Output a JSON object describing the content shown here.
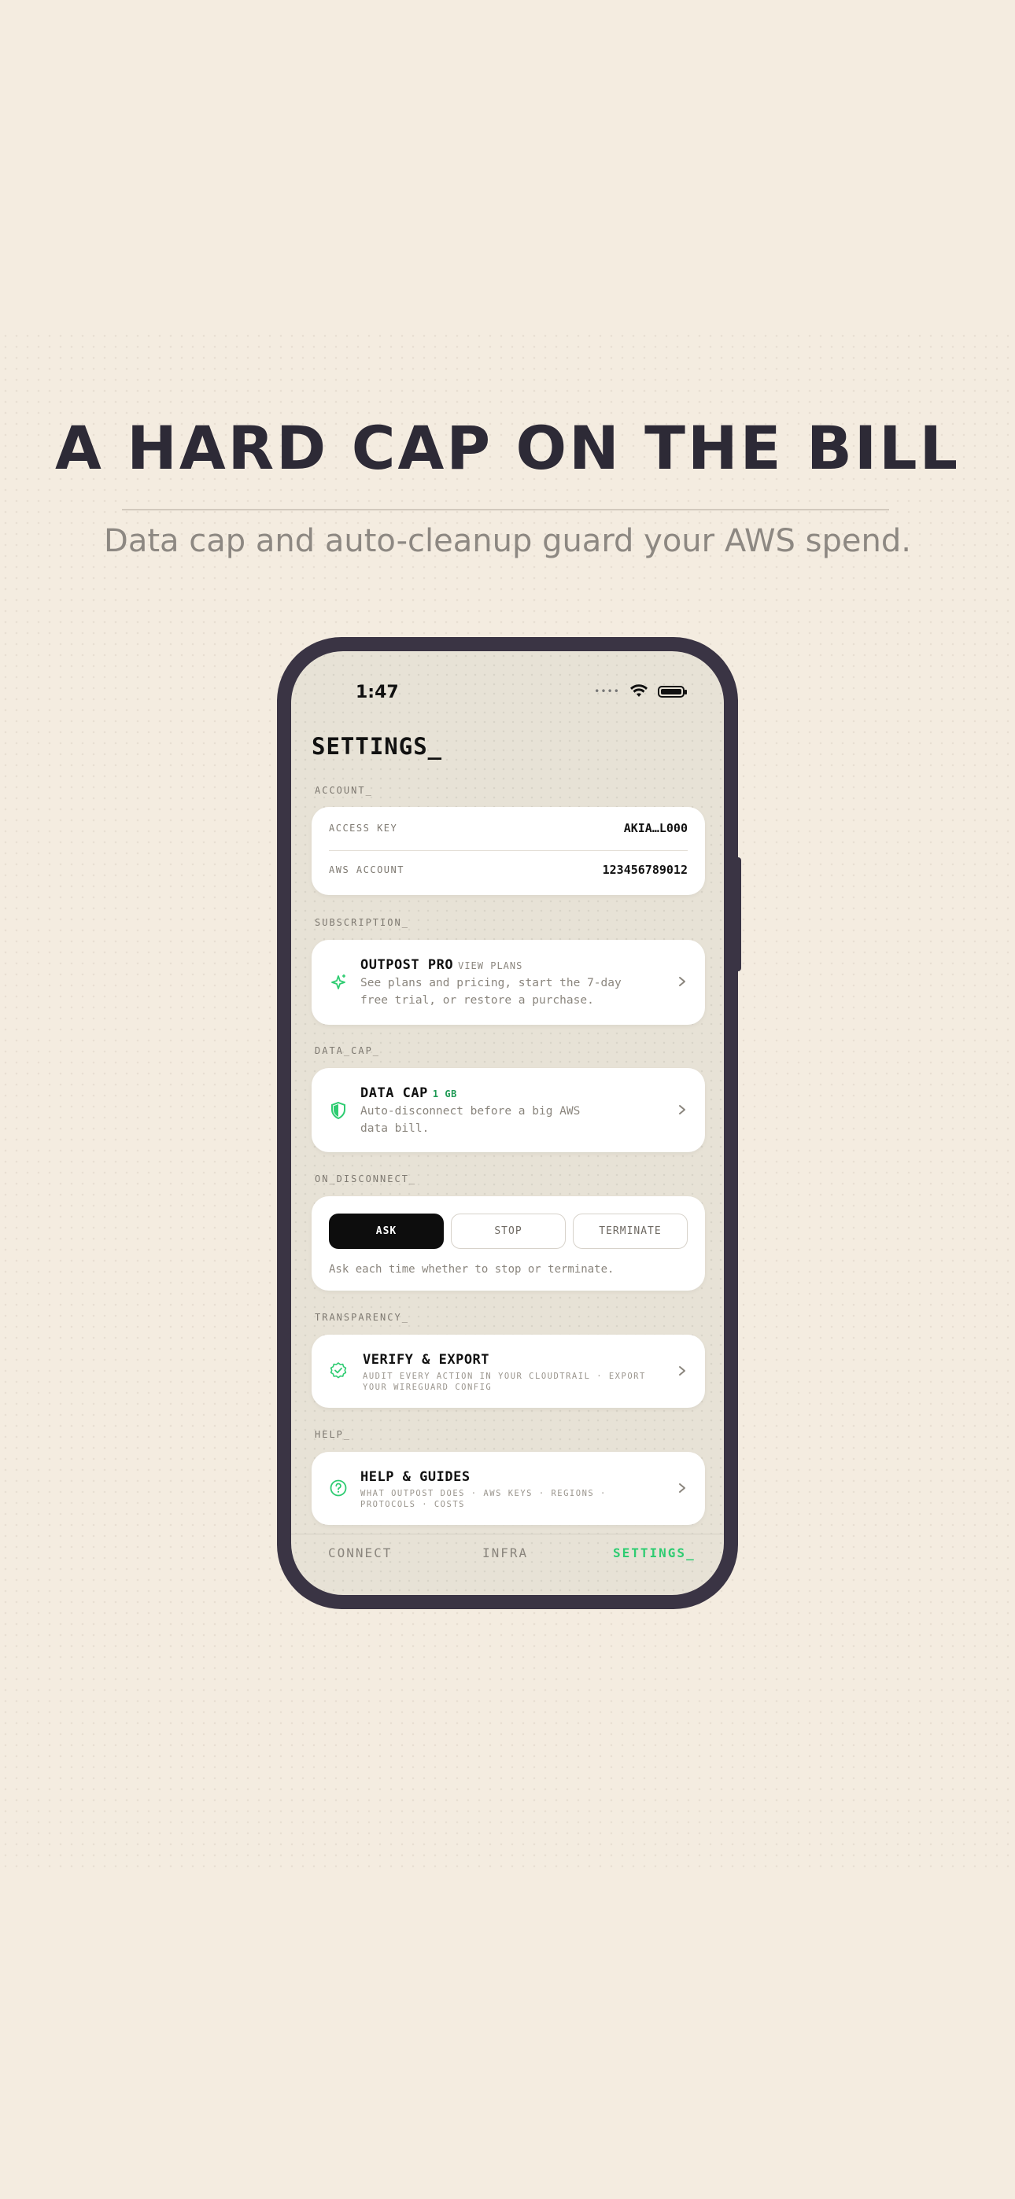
{
  "marketing": {
    "headline": "A HARD CAP ON THE BILL",
    "subheadline": "Data cap and auto-cleanup guard your AWS spend."
  },
  "status_bar": {
    "time": "1:47",
    "signal": "••••",
    "icons": [
      "wifi-icon",
      "battery-icon"
    ]
  },
  "screen": {
    "title": "SETTINGS_"
  },
  "account": {
    "section_label": "ACCOUNT_",
    "rows": [
      {
        "key": "ACCESS KEY",
        "value": "AKIA…L000"
      },
      {
        "key": "AWS ACCOUNT",
        "value": "123456789012"
      }
    ]
  },
  "subscription": {
    "section_label": "SUBSCRIPTION_",
    "title": "OUTPOST PRO",
    "tag": "VIEW PLANS",
    "description": "See plans and pricing, start the 7-day free trial, or restore a purchase.",
    "icon": "sparkle-icon"
  },
  "data_cap": {
    "section_label": "DATA_CAP_",
    "title": "DATA CAP",
    "value": "1 GB",
    "description": "Auto-disconnect before a big AWS data bill.",
    "icon": "shield-icon"
  },
  "on_disconnect": {
    "section_label": "ON_DISCONNECT_",
    "options": [
      "ASK",
      "STOP",
      "TERMINATE"
    ],
    "selected": "ASK",
    "hint": "Ask each time whether to stop or terminate."
  },
  "transparency": {
    "section_label": "TRANSPARENCY_",
    "title": "VERIFY & EXPORT",
    "caption": "AUDIT EVERY ACTION IN YOUR CLOUDTRAIL · EXPORT YOUR WIREGUARD CONFIG",
    "icon": "verified-badge-icon"
  },
  "help": {
    "section_label": "HELP_",
    "title": "HELP & GUIDES",
    "caption": "WHAT OUTPOST DOES · AWS KEYS · REGIONS · PROTOCOLS · COSTS",
    "icon": "help-circle-icon"
  },
  "tabs": [
    {
      "label": "CONNECT",
      "active": false
    },
    {
      "label": "INFRA",
      "active": false
    },
    {
      "label": "SETTINGS_",
      "active": true
    }
  ],
  "colors": {
    "accent": "#2ecc71",
    "background": "#f4ece0",
    "phone_frame": "#3a3444",
    "screen_bg": "#e7e2d6"
  }
}
